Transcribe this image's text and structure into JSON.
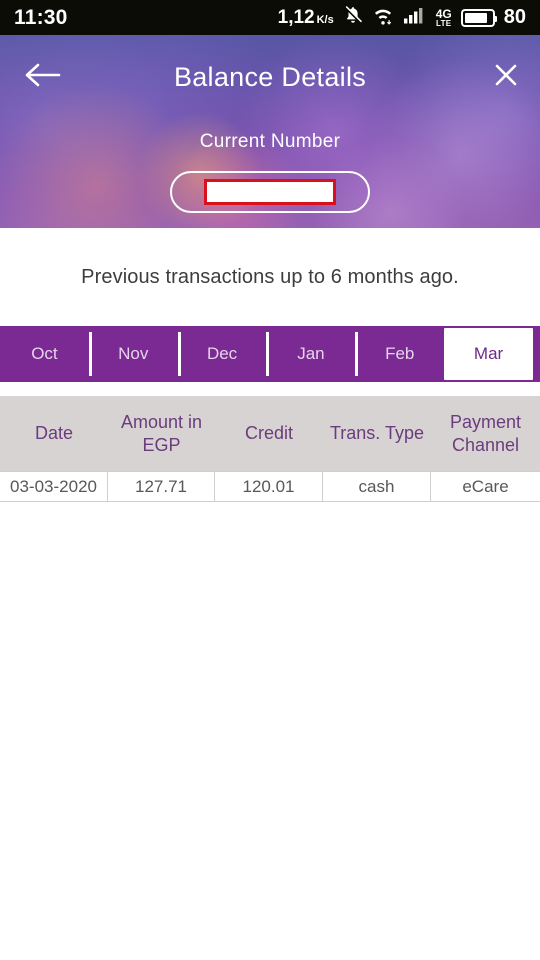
{
  "status_bar": {
    "time": "11:30",
    "data_rate": "1,12",
    "data_rate_unit": "K/s",
    "icons": [
      "bell-muted-icon",
      "wifi-icon",
      "cellular-signal-icon"
    ],
    "network_type_primary": "4G",
    "network_type_secondary": "LTE",
    "battery_percent": "80"
  },
  "header": {
    "title": "Balance Details",
    "back_icon": "arrow-left-icon",
    "close_icon": "close-icon",
    "current_number_label": "Current Number",
    "current_number_value": "",
    "redacted": true,
    "colors": {
      "redaction_border": "#d8111a",
      "title_text": "#ffffff"
    }
  },
  "note": {
    "text": "Previous transactions up to 6 months ago."
  },
  "month_tabs": {
    "active_index": 5,
    "items": [
      {
        "label": "Oct"
      },
      {
        "label": "Nov"
      },
      {
        "label": "Dec"
      },
      {
        "label": "Jan"
      },
      {
        "label": "Feb"
      },
      {
        "label": "Mar"
      }
    ],
    "colors": {
      "bar": "#7a2a92",
      "active_bg": "#ffffff",
      "active_text": "#6e2a86",
      "inactive_text": "#e7d4ec"
    }
  },
  "transactions_table": {
    "headers": [
      "Date",
      "Amount in EGP",
      "Credit",
      "Trans. Type",
      "Payment Channel"
    ],
    "rows": [
      {
        "date": "03-03-2020",
        "amount_egp": "127.71",
        "credit": "120.01",
        "trans_type": "cash",
        "payment_channel": "eCare"
      }
    ],
    "colors": {
      "header_bg": "#d7d3d3",
      "header_text": "#6b3c7d",
      "cell_text": "#58585a"
    }
  }
}
